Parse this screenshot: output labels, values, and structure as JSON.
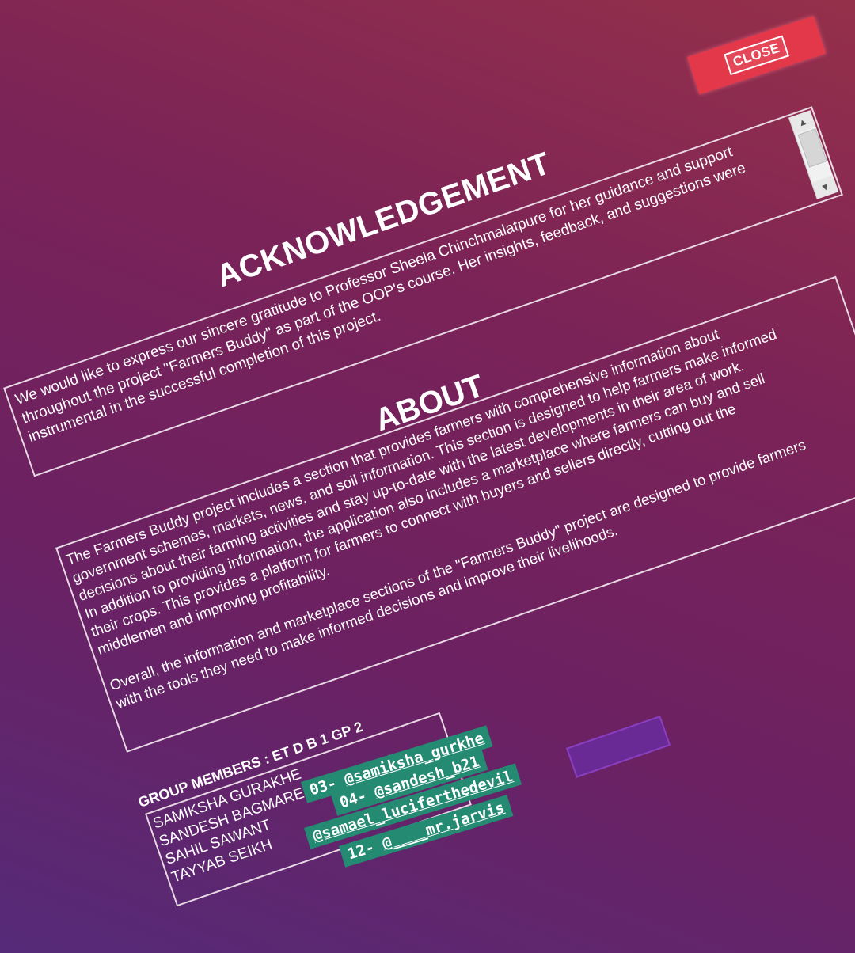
{
  "close_label": "CLOSE",
  "acknowledgement": {
    "heading": "ACKNOWLEDGEMENT",
    "lines": [
      "We would like to express our sincere gratitude to Professor Sheela Chinchmalatpure for her guidance and support",
      "throughout the project \"Farmers Buddy\" as part of the OOP's course. Her insights, feedback, and suggestions were",
      "instrumental in the successful completion of this project."
    ]
  },
  "about": {
    "heading": "ABOUT",
    "paragraph1": [
      "The Farmers Buddy project includes a section that provides farmers with comprehensive information about",
      "government schemes, markets, news, and soil information. This section is designed to help farmers make informed",
      "decisions about their farming activities and stay up-to-date with the latest developments in their area of work.",
      "In addition to providing information, the application also includes a marketplace where farmers can buy and sell",
      "their crops. This provides a platform for farmers to connect with buyers and sellers directly, cutting out the",
      "middlemen and improving profitability."
    ],
    "paragraph2": [
      "Overall, the information and marketplace sections of the \"Farmers Buddy\" project are designed to provide farmers",
      "with the tools they need to make informed decisions and improve their livelihoods."
    ]
  },
  "group": {
    "header": "GROUP MEMBERS : ET D  B 1  GP 2",
    "members": [
      "SAMIKSHA GURAKHE",
      "SANDESH BAGMARE",
      "SAHIL SAWANT",
      "TAYYAB SEIKH"
    ]
  },
  "handles": [
    {
      "prefix": "03- ",
      "handle": "@samiksha_gurkhe"
    },
    {
      "prefix": "04- ",
      "handle": "@sandesh_b21"
    },
    {
      "prefix": "",
      "handle": "@samael_luciferthedevil"
    },
    {
      "prefix": "12- ",
      "handle": "@____mr.jarvis"
    }
  ]
}
